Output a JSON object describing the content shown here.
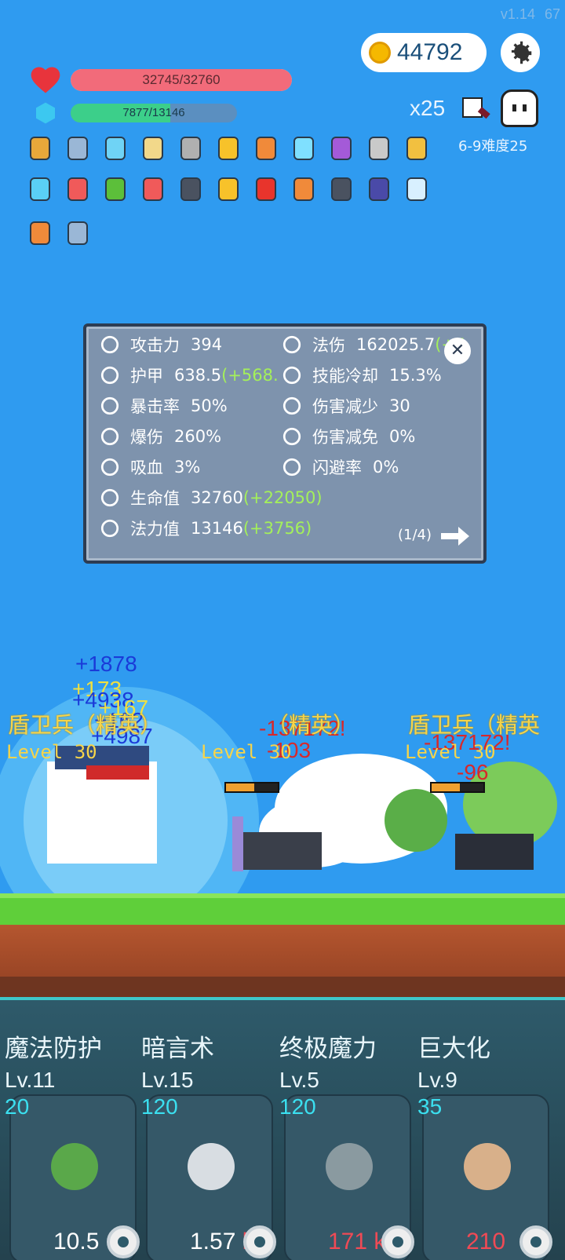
{
  "version": {
    "label": "v1.14",
    "fps": "67"
  },
  "coins": {
    "value": "44792"
  },
  "player": {
    "hp_text": "32745/32760",
    "hp_fraction": 0.9995,
    "mp_text": "7877/13146",
    "mp_fraction": 0.599
  },
  "stage": {
    "multiplier": "x25",
    "difficulty": "6-9难度25"
  },
  "items": [
    {
      "name": "book-icon",
      "color": "#e8a83a"
    },
    {
      "name": "shield-icon",
      "color": "#9ab7d6"
    },
    {
      "name": "diamond-icon",
      "color": "#6fd3f5"
    },
    {
      "name": "scroll-icon",
      "color": "#f2d88a"
    },
    {
      "name": "axe-icon",
      "color": "#b0b0b0"
    },
    {
      "name": "sun-icon",
      "color": "#f7c22a"
    },
    {
      "name": "torch-icon",
      "color": "#f08a3a"
    },
    {
      "name": "ice-crystal-icon",
      "color": "#7fe0ff"
    },
    {
      "name": "crystal-ball-icon",
      "color": "#a45ad8"
    },
    {
      "name": "sword-icon",
      "color": "#c9c9c9"
    },
    {
      "name": "ring-icon",
      "color": "#f2c040"
    },
    {
      "name": "blue-crystal-icon",
      "color": "#5ad0f5"
    },
    {
      "name": "pill-icon",
      "color": "#f05a5a"
    },
    {
      "name": "sapling-icon",
      "color": "#5cbf3a"
    },
    {
      "name": "pill-icon",
      "color": "#f05a5a"
    },
    {
      "name": "skull-book-icon",
      "color": "#4a5260"
    },
    {
      "name": "sun-icon",
      "color": "#f7c22a"
    },
    {
      "name": "apple-icon",
      "color": "#e8342c"
    },
    {
      "name": "torch-icon",
      "color": "#f08a3a"
    },
    {
      "name": "skull-book-icon",
      "color": "#4a5260"
    },
    {
      "name": "wizard-hat-icon",
      "color": "#4a4aa8"
    },
    {
      "name": "wind-icon",
      "color": "#d8f0ff"
    },
    {
      "name": "torch-icon",
      "color": "#f08a3a"
    },
    {
      "name": "shield-icon",
      "color": "#9ab7d6"
    }
  ],
  "stats": {
    "left": [
      {
        "icon": "attack-icon",
        "label": "攻击力",
        "value": "394",
        "bonus": ""
      },
      {
        "icon": "armor-icon",
        "label": "护甲",
        "value": "638.5",
        "bonus": "(+568."
      },
      {
        "icon": "crit-rate-icon",
        "label": "暴击率",
        "value": "50%",
        "bonus": ""
      },
      {
        "icon": "crit-damage-icon",
        "label": "爆伤",
        "value": "260%",
        "bonus": ""
      },
      {
        "icon": "lifesteal-icon",
        "label": "吸血",
        "value": "3%",
        "bonus": ""
      },
      {
        "icon": "hourglass-icon",
        "label": "生命值",
        "value": "32760",
        "bonus": "(+22050)"
      },
      {
        "icon": "mana-skull-icon",
        "label": "法力值",
        "value": "13146",
        "bonus": "(+3756)"
      }
    ],
    "right": [
      {
        "icon": "magic-wand-icon",
        "label": "法伤",
        "value": "162025.7",
        "bonus": "(+5"
      },
      {
        "icon": "cooldown-shield-icon",
        "label": "技能冷却",
        "value": "15.3%",
        "bonus": ""
      },
      {
        "icon": "damage-reduce-icon",
        "label": "伤害减少",
        "value": "30",
        "bonus": ""
      },
      {
        "icon": "heart-icon",
        "label": "伤害减免",
        "value": "0%",
        "bonus": ""
      },
      {
        "icon": "dodge-icon",
        "label": "闪避率",
        "value": "0%",
        "bonus": ""
      }
    ],
    "page": "(1/4)"
  },
  "battle": {
    "heal_numbers": [
      "+1878",
      "+173",
      "+4938",
      "+162",
      "+167",
      "+4987"
    ],
    "damage_numbers": [
      "-137172!",
      "-103",
      "-137172!",
      "-96"
    ],
    "enemies": [
      {
        "name": "盾卫兵（精英）",
        "level": "Level 30"
      },
      {
        "name": "（精英）",
        "level": "Level 30"
      },
      {
        "name": "盾卫兵（精英",
        "level": "Level 30"
      }
    ]
  },
  "skills": [
    {
      "name": "魔法防护",
      "level": "Lv.11",
      "cost": "20",
      "damage": "10.5",
      "unit": "",
      "red": false,
      "icon": "leaf-icon"
    },
    {
      "name": "暗言术",
      "level": "Lv.15",
      "cost": "120",
      "damage": "1.57",
      "unit": "k",
      "red": false,
      "icon": "ghost-icon"
    },
    {
      "name": "终极魔力",
      "level": "Lv.5",
      "cost": "120",
      "damage": "171",
      "unit": "k",
      "red": true,
      "icon": "eye-icon"
    },
    {
      "name": "巨大化",
      "level": "Lv.9",
      "cost": "35",
      "damage": "210",
      "unit": "",
      "red": true,
      "icon": "fist-icon"
    }
  ]
}
